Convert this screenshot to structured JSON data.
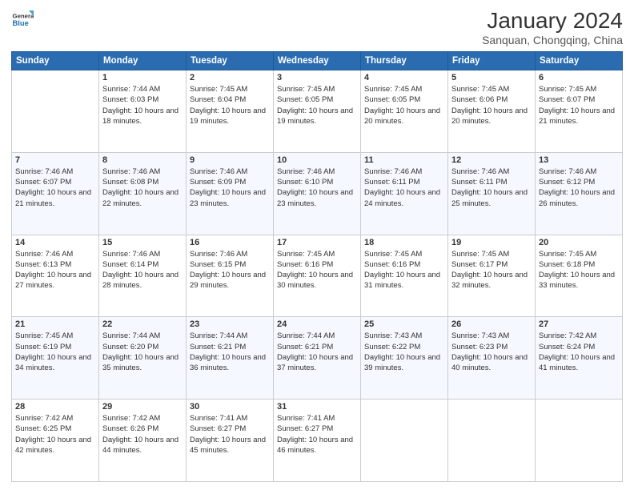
{
  "header": {
    "logo_line1": "General",
    "logo_line2": "Blue",
    "title": "January 2024",
    "subtitle": "Sanquan, Chongqing, China"
  },
  "columns": [
    "Sunday",
    "Monday",
    "Tuesday",
    "Wednesday",
    "Thursday",
    "Friday",
    "Saturday"
  ],
  "weeks": [
    [
      {
        "day": "",
        "sunrise": "",
        "sunset": "",
        "daylight": ""
      },
      {
        "day": "1",
        "sunrise": "Sunrise: 7:44 AM",
        "sunset": "Sunset: 6:03 PM",
        "daylight": "Daylight: 10 hours and 18 minutes."
      },
      {
        "day": "2",
        "sunrise": "Sunrise: 7:45 AM",
        "sunset": "Sunset: 6:04 PM",
        "daylight": "Daylight: 10 hours and 19 minutes."
      },
      {
        "day": "3",
        "sunrise": "Sunrise: 7:45 AM",
        "sunset": "Sunset: 6:05 PM",
        "daylight": "Daylight: 10 hours and 19 minutes."
      },
      {
        "day": "4",
        "sunrise": "Sunrise: 7:45 AM",
        "sunset": "Sunset: 6:05 PM",
        "daylight": "Daylight: 10 hours and 20 minutes."
      },
      {
        "day": "5",
        "sunrise": "Sunrise: 7:45 AM",
        "sunset": "Sunset: 6:06 PM",
        "daylight": "Daylight: 10 hours and 20 minutes."
      },
      {
        "day": "6",
        "sunrise": "Sunrise: 7:45 AM",
        "sunset": "Sunset: 6:07 PM",
        "daylight": "Daylight: 10 hours and 21 minutes."
      }
    ],
    [
      {
        "day": "7",
        "sunrise": "Sunrise: 7:46 AM",
        "sunset": "Sunset: 6:07 PM",
        "daylight": "Daylight: 10 hours and 21 minutes."
      },
      {
        "day": "8",
        "sunrise": "Sunrise: 7:46 AM",
        "sunset": "Sunset: 6:08 PM",
        "daylight": "Daylight: 10 hours and 22 minutes."
      },
      {
        "day": "9",
        "sunrise": "Sunrise: 7:46 AM",
        "sunset": "Sunset: 6:09 PM",
        "daylight": "Daylight: 10 hours and 23 minutes."
      },
      {
        "day": "10",
        "sunrise": "Sunrise: 7:46 AM",
        "sunset": "Sunset: 6:10 PM",
        "daylight": "Daylight: 10 hours and 23 minutes."
      },
      {
        "day": "11",
        "sunrise": "Sunrise: 7:46 AM",
        "sunset": "Sunset: 6:11 PM",
        "daylight": "Daylight: 10 hours and 24 minutes."
      },
      {
        "day": "12",
        "sunrise": "Sunrise: 7:46 AM",
        "sunset": "Sunset: 6:11 PM",
        "daylight": "Daylight: 10 hours and 25 minutes."
      },
      {
        "day": "13",
        "sunrise": "Sunrise: 7:46 AM",
        "sunset": "Sunset: 6:12 PM",
        "daylight": "Daylight: 10 hours and 26 minutes."
      }
    ],
    [
      {
        "day": "14",
        "sunrise": "Sunrise: 7:46 AM",
        "sunset": "Sunset: 6:13 PM",
        "daylight": "Daylight: 10 hours and 27 minutes."
      },
      {
        "day": "15",
        "sunrise": "Sunrise: 7:46 AM",
        "sunset": "Sunset: 6:14 PM",
        "daylight": "Daylight: 10 hours and 28 minutes."
      },
      {
        "day": "16",
        "sunrise": "Sunrise: 7:46 AM",
        "sunset": "Sunset: 6:15 PM",
        "daylight": "Daylight: 10 hours and 29 minutes."
      },
      {
        "day": "17",
        "sunrise": "Sunrise: 7:45 AM",
        "sunset": "Sunset: 6:16 PM",
        "daylight": "Daylight: 10 hours and 30 minutes."
      },
      {
        "day": "18",
        "sunrise": "Sunrise: 7:45 AM",
        "sunset": "Sunset: 6:16 PM",
        "daylight": "Daylight: 10 hours and 31 minutes."
      },
      {
        "day": "19",
        "sunrise": "Sunrise: 7:45 AM",
        "sunset": "Sunset: 6:17 PM",
        "daylight": "Daylight: 10 hours and 32 minutes."
      },
      {
        "day": "20",
        "sunrise": "Sunrise: 7:45 AM",
        "sunset": "Sunset: 6:18 PM",
        "daylight": "Daylight: 10 hours and 33 minutes."
      }
    ],
    [
      {
        "day": "21",
        "sunrise": "Sunrise: 7:45 AM",
        "sunset": "Sunset: 6:19 PM",
        "daylight": "Daylight: 10 hours and 34 minutes."
      },
      {
        "day": "22",
        "sunrise": "Sunrise: 7:44 AM",
        "sunset": "Sunset: 6:20 PM",
        "daylight": "Daylight: 10 hours and 35 minutes."
      },
      {
        "day": "23",
        "sunrise": "Sunrise: 7:44 AM",
        "sunset": "Sunset: 6:21 PM",
        "daylight": "Daylight: 10 hours and 36 minutes."
      },
      {
        "day": "24",
        "sunrise": "Sunrise: 7:44 AM",
        "sunset": "Sunset: 6:21 PM",
        "daylight": "Daylight: 10 hours and 37 minutes."
      },
      {
        "day": "25",
        "sunrise": "Sunrise: 7:43 AM",
        "sunset": "Sunset: 6:22 PM",
        "daylight": "Daylight: 10 hours and 39 minutes."
      },
      {
        "day": "26",
        "sunrise": "Sunrise: 7:43 AM",
        "sunset": "Sunset: 6:23 PM",
        "daylight": "Daylight: 10 hours and 40 minutes."
      },
      {
        "day": "27",
        "sunrise": "Sunrise: 7:42 AM",
        "sunset": "Sunset: 6:24 PM",
        "daylight": "Daylight: 10 hours and 41 minutes."
      }
    ],
    [
      {
        "day": "28",
        "sunrise": "Sunrise: 7:42 AM",
        "sunset": "Sunset: 6:25 PM",
        "daylight": "Daylight: 10 hours and 42 minutes."
      },
      {
        "day": "29",
        "sunrise": "Sunrise: 7:42 AM",
        "sunset": "Sunset: 6:26 PM",
        "daylight": "Daylight: 10 hours and 44 minutes."
      },
      {
        "day": "30",
        "sunrise": "Sunrise: 7:41 AM",
        "sunset": "Sunset: 6:27 PM",
        "daylight": "Daylight: 10 hours and 45 minutes."
      },
      {
        "day": "31",
        "sunrise": "Sunrise: 7:41 AM",
        "sunset": "Sunset: 6:27 PM",
        "daylight": "Daylight: 10 hours and 46 minutes."
      },
      {
        "day": "",
        "sunrise": "",
        "sunset": "",
        "daylight": ""
      },
      {
        "day": "",
        "sunrise": "",
        "sunset": "",
        "daylight": ""
      },
      {
        "day": "",
        "sunrise": "",
        "sunset": "",
        "daylight": ""
      }
    ]
  ]
}
